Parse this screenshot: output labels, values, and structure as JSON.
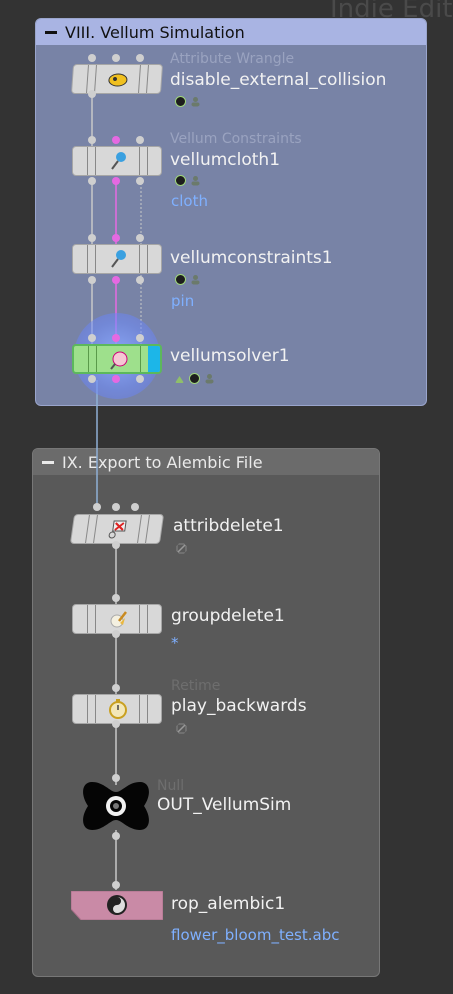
{
  "watermark": "Indie Editi",
  "boxes": {
    "vellum": {
      "title": "VIII. Vellum Simulation"
    },
    "export": {
      "title": "IX. Export to Alembic File"
    }
  },
  "nodes": [
    {
      "id": "attribwrangle",
      "type_label": "Attribute Wrangle",
      "name": "disable_external_collision",
      "sub": "",
      "icon": "wrangle-icon"
    },
    {
      "id": "vellumcloth",
      "type_label": "Vellum Constraints",
      "name": "vellumcloth1",
      "sub": "cloth",
      "icon": "pin-icon"
    },
    {
      "id": "vellumconstraints",
      "type_label": "",
      "name": "vellumconstraints1",
      "sub": "pin",
      "icon": "pin-icon"
    },
    {
      "id": "vellumsolver",
      "type_label": "",
      "name": "vellumsolver1",
      "sub": "",
      "icon": "solver-icon"
    },
    {
      "id": "attribdelete",
      "type_label": "",
      "name": "attribdelete1",
      "sub": "",
      "icon": "attrib-delete-icon"
    },
    {
      "id": "groupdelete",
      "type_label": "",
      "name": "groupdelete1",
      "sub": "*",
      "icon": "broom-icon"
    },
    {
      "id": "retime",
      "type_label": "Retime",
      "name": "play_backwards",
      "sub": "",
      "icon": "stopwatch-icon"
    },
    {
      "id": "null",
      "type_label": "Null",
      "name": "OUT_VellumSim",
      "sub": "",
      "icon": "null-icon"
    },
    {
      "id": "rop",
      "type_label": "",
      "name": "rop_alembic1",
      "sub": "flower_bloom_test.abc",
      "icon": "alembic-icon"
    }
  ]
}
